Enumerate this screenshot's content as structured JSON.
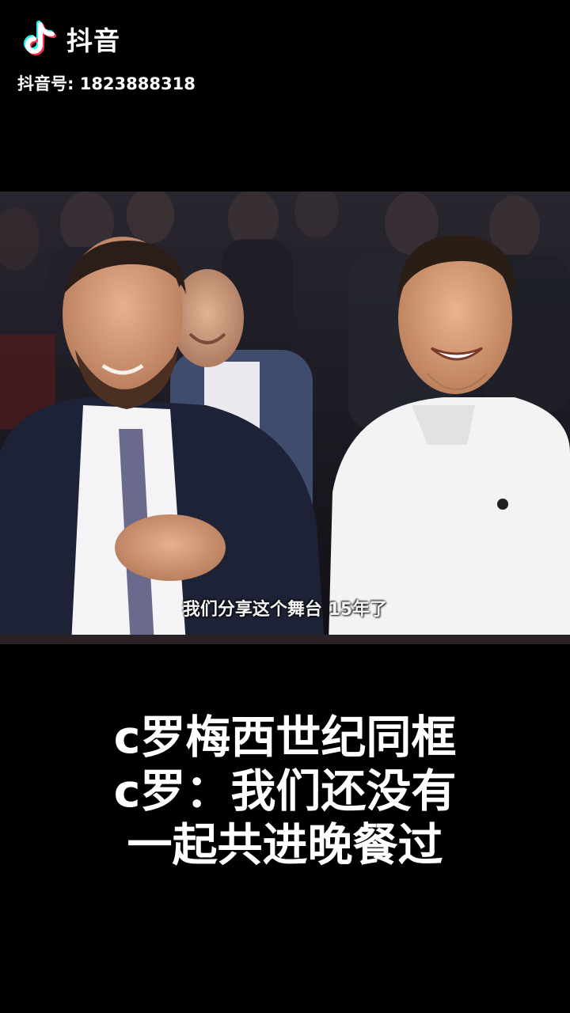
{
  "watermark": {
    "app_name": "抖音",
    "account_label": "抖音号: 1823888318"
  },
  "video": {
    "subtitle": "我们分享这个舞台 15年了"
  },
  "caption": {
    "lines": [
      "c罗梅西世纪同框",
      "c罗：我们还没有",
      "一起共进晚餐过"
    ]
  },
  "colors": {
    "background": "#000000",
    "text": "#ffffff",
    "tiktok_cyan": "#25f4ee",
    "tiktok_red": "#fe2c55"
  },
  "icons": {
    "logo": "douyin-note-icon"
  }
}
